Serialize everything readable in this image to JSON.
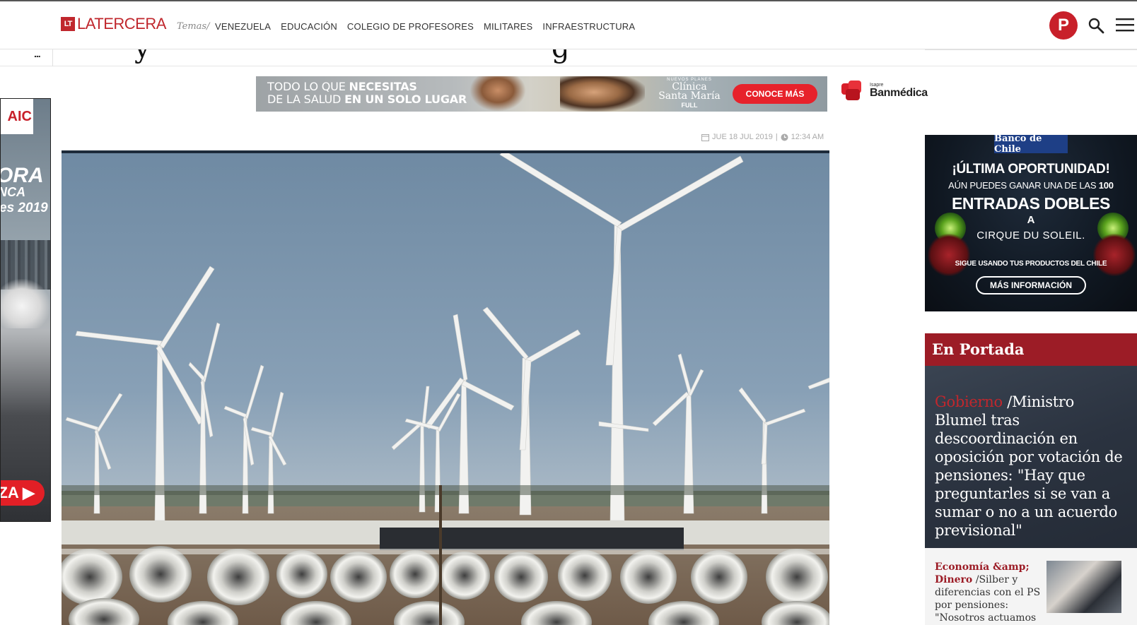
{
  "header": {
    "logo_mark": "LT",
    "logo_text": "LATERCERA",
    "temas_label": "Temas/",
    "nav": [
      "VENEZUELA",
      "EDUCACIÓN",
      "COLEGIO DE PROFESORES",
      "MILITARES",
      "INFRAESTRUCTURA"
    ],
    "avatar_letter": "P",
    "icons": {
      "search": "search-icon",
      "menu": "menu-icon"
    },
    "accent_color": "#c0272d"
  },
  "subbar": {
    "dots": "...",
    "fragment_left": "y",
    "fragment_right": "g"
  },
  "top_ad": {
    "line1_a": "TODO LO QUE ",
    "line1_b": "NECESITAS",
    "line2_a": "DE LA SALUD ",
    "line2_b": "EN UN SOLO LUGAR",
    "clinica_tag": "NUEVOS PLANES",
    "clinica_name_1": "Clínica",
    "clinica_name_2": "Santa María",
    "clinica_full": "FULL",
    "cta": "CONOCE MÁS",
    "sponsor_small": "Isapre",
    "sponsor": "Banmédica"
  },
  "left_ad": {
    "brand": "AIC",
    "text1": "ORA",
    "text2": "NCA",
    "text3": "es 2019",
    "cta": "ZA ▶"
  },
  "article": {
    "date": "JUE 18 JUL 2019",
    "separator": "|",
    "time": "12:34 AM"
  },
  "right_ad": {
    "bank": "Banco de Chile",
    "line1": "¡ÚLTIMA OPORTUNIDAD!",
    "line2_a": "AÚN PUEDES GANAR UNA DE LAS ",
    "line2_b": "100",
    "line3": "ENTRADAS DOBLES",
    "line4": "A",
    "line5": "CIRQUE DU SOLEIL.",
    "line6": "SIGUE USANDO TUS PRODUCTOS DEL CHILE",
    "cta": "MÁS INFORMACIÓN"
  },
  "portada": {
    "heading": "En Portada",
    "main": {
      "category": "Gobierno",
      "slash": " /",
      "title": "Ministro Blumel tras descoordinación en oposición por votación de pensiones: \"Hay que preguntarles si se van a sumar o no a un acuerdo previsional\""
    },
    "item": {
      "category": "Economía &amp; Dinero",
      "slash": " /",
      "title": "Silber y diferencias con el PS por pensiones: \"Nosotros actuamos"
    }
  }
}
